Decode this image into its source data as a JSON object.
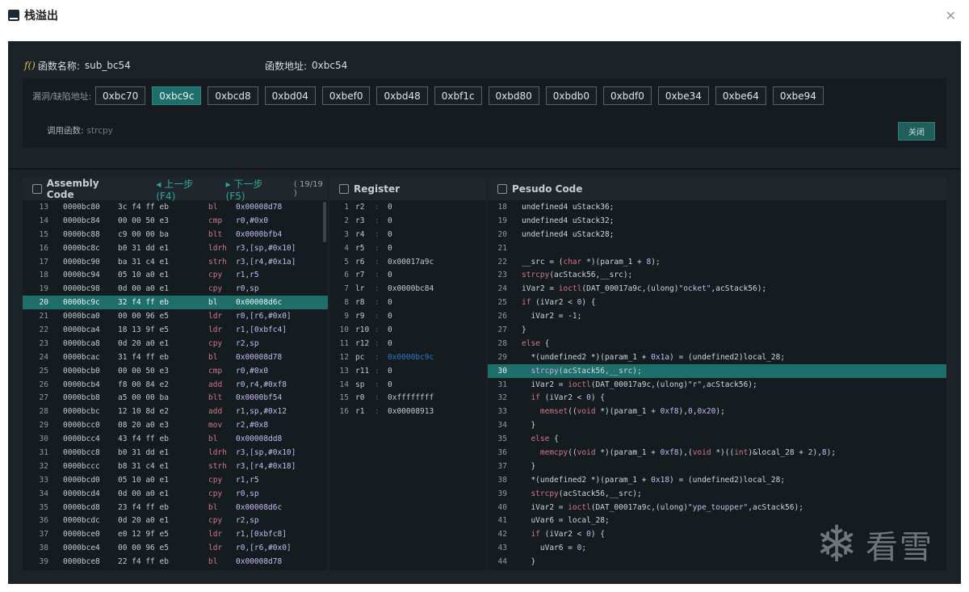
{
  "window": {
    "title": "栈溢出"
  },
  "function_info": {
    "name_label": "函数名称:",
    "name": "sub_bc54",
    "addr_label": "函数地址:",
    "addr": "0xbc54"
  },
  "vuln": {
    "label": "漏洞/缺陷地址:",
    "addresses": [
      "0xbc70",
      "0xbc9c",
      "0xbcd8",
      "0xbd04",
      "0xbef0",
      "0xbd48",
      "0xbf1c",
      "0xbd80",
      "0xbdb0",
      "0xbdf0",
      "0xbe34",
      "0xbe64",
      "0xbe94"
    ],
    "active_index": 1,
    "call_label": "调用函数:",
    "call_fn": "strcpy",
    "close_label": "关闭"
  },
  "assembly": {
    "title": "Assembly Code",
    "prev_label": "上一步(F4)",
    "next_label": "下一步(F5)",
    "step_count": "( 19/19 )",
    "highlight_line": "20",
    "rows": [
      {
        "ln": "13",
        "addr": "0000bc80",
        "bytes": "3c f4 ff eb",
        "mn": "bl",
        "op": "0x00008d78"
      },
      {
        "ln": "14",
        "addr": "0000bc84",
        "bytes": "00 00 50 e3",
        "mn": "cmp",
        "op": "r0,#0x0"
      },
      {
        "ln": "15",
        "addr": "0000bc88",
        "bytes": "c9 00 00 ba",
        "mn": "blt",
        "op": "0x0000bfb4"
      },
      {
        "ln": "16",
        "addr": "0000bc8c",
        "bytes": "b0 31 dd e1",
        "mn": "ldrh",
        "op": "r3,[sp,#0x10]"
      },
      {
        "ln": "17",
        "addr": "0000bc90",
        "bytes": "ba 31 c4 e1",
        "mn": "strh",
        "op": "r3,[r4,#0x1a]"
      },
      {
        "ln": "18",
        "addr": "0000bc94",
        "bytes": "05 10 a0 e1",
        "mn": "cpy",
        "op": "r1,r5"
      },
      {
        "ln": "19",
        "addr": "0000bc98",
        "bytes": "0d 00 a0 e1",
        "mn": "cpy",
        "op": "r0,sp"
      },
      {
        "ln": "20",
        "addr": "0000bc9c",
        "bytes": "32 f4 ff eb",
        "mn": "bl",
        "op": "0x00008d6c"
      },
      {
        "ln": "21",
        "addr": "0000bca0",
        "bytes": "00 00 96 e5",
        "mn": "ldr",
        "op": "r0,[r6,#0x0]"
      },
      {
        "ln": "22",
        "addr": "0000bca4",
        "bytes": "18 13 9f e5",
        "mn": "ldr",
        "op": "r1,[0xbfc4]"
      },
      {
        "ln": "23",
        "addr": "0000bca8",
        "bytes": "0d 20 a0 e1",
        "mn": "cpy",
        "op": "r2,sp"
      },
      {
        "ln": "24",
        "addr": "0000bcac",
        "bytes": "31 f4 ff eb",
        "mn": "bl",
        "op": "0x00008d78"
      },
      {
        "ln": "25",
        "addr": "0000bcb0",
        "bytes": "00 00 50 e3",
        "mn": "cmp",
        "op": "r0,#0x0"
      },
      {
        "ln": "26",
        "addr": "0000bcb4",
        "bytes": "f8 00 84 e2",
        "mn": "add",
        "op": "r0,r4,#0xf8"
      },
      {
        "ln": "27",
        "addr": "0000bcb8",
        "bytes": "a5 00 00 ba",
        "mn": "blt",
        "op": "0x0000bf54"
      },
      {
        "ln": "28",
        "addr": "0000bcbc",
        "bytes": "12 10 8d e2",
        "mn": "add",
        "op": "r1,sp,#0x12"
      },
      {
        "ln": "29",
        "addr": "0000bcc0",
        "bytes": "08 20 a0 e3",
        "mn": "mov",
        "op": "r2,#0x8"
      },
      {
        "ln": "30",
        "addr": "0000bcc4",
        "bytes": "43 f4 ff eb",
        "mn": "bl",
        "op": "0x00008dd8"
      },
      {
        "ln": "31",
        "addr": "0000bcc8",
        "bytes": "b0 31 dd e1",
        "mn": "ldrh",
        "op": "r3,[sp,#0x10]"
      },
      {
        "ln": "32",
        "addr": "0000bccc",
        "bytes": "b8 31 c4 e1",
        "mn": "strh",
        "op": "r3,[r4,#0x18]"
      },
      {
        "ln": "33",
        "addr": "0000bcd0",
        "bytes": "05 10 a0 e1",
        "mn": "cpy",
        "op": "r1,r5"
      },
      {
        "ln": "34",
        "addr": "0000bcd4",
        "bytes": "0d 00 a0 e1",
        "mn": "cpy",
        "op": "r0,sp"
      },
      {
        "ln": "35",
        "addr": "0000bcd8",
        "bytes": "23 f4 ff eb",
        "mn": "bl",
        "op": "0x00008d6c"
      },
      {
        "ln": "36",
        "addr": "0000bcdc",
        "bytes": "0d 20 a0 e1",
        "mn": "cpy",
        "op": "r2,sp"
      },
      {
        "ln": "37",
        "addr": "0000bce0",
        "bytes": "e0 12 9f e5",
        "mn": "ldr",
        "op": "r1,[0xbfc8]"
      },
      {
        "ln": "38",
        "addr": "0000bce4",
        "bytes": "00 00 96 e5",
        "mn": "ldr",
        "op": "r0,[r6,#0x0]"
      },
      {
        "ln": "39",
        "addr": "0000bce8",
        "bytes": "22 f4 ff eb",
        "mn": "bl",
        "op": "0x00008d78"
      }
    ]
  },
  "register": {
    "title": "Register",
    "rows": [
      {
        "ln": "1",
        "name": "r2",
        "sep": ":",
        "value": "0",
        "changed": false
      },
      {
        "ln": "2",
        "name": "r3",
        "sep": ":",
        "value": "0",
        "changed": false
      },
      {
        "ln": "3",
        "name": "r4",
        "sep": ":",
        "value": "0",
        "changed": false
      },
      {
        "ln": "4",
        "name": "r5",
        "sep": ":",
        "value": "0",
        "changed": false
      },
      {
        "ln": "5",
        "name": "r6",
        "sep": ":",
        "value": "0x00017a9c",
        "changed": false
      },
      {
        "ln": "6",
        "name": "r7",
        "sep": ":",
        "value": "0",
        "changed": false
      },
      {
        "ln": "7",
        "name": "lr",
        "sep": ":",
        "value": "0x0000bc84",
        "changed": false
      },
      {
        "ln": "8",
        "name": "r8",
        "sep": ":",
        "value": "0",
        "changed": false
      },
      {
        "ln": "9",
        "name": "r9",
        "sep": ":",
        "value": "0",
        "changed": false
      },
      {
        "ln": "10",
        "name": "r10",
        "sep": ":",
        "value": "0",
        "changed": false
      },
      {
        "ln": "11",
        "name": "r12",
        "sep": ":",
        "value": "0",
        "changed": false
      },
      {
        "ln": "12",
        "name": "pc",
        "sep": ":",
        "value": "0x0000bc9c",
        "changed": true
      },
      {
        "ln": "13",
        "name": "r11",
        "sep": ":",
        "value": "0",
        "changed": false
      },
      {
        "ln": "14",
        "name": "sp",
        "sep": ":",
        "value": "0",
        "changed": false
      },
      {
        "ln": "15",
        "name": "r0",
        "sep": ":",
        "value": "0xffffffff",
        "changed": false
      },
      {
        "ln": "16",
        "name": "r1",
        "sep": ":",
        "value": "0x00008913",
        "changed": false
      }
    ]
  },
  "pseudo": {
    "title": "Pesudo Code",
    "highlight_line": "30",
    "rows": [
      {
        "ln": "18",
        "code": "undefined4 uStack36;"
      },
      {
        "ln": "19",
        "code": "undefined4 uStack32;"
      },
      {
        "ln": "20",
        "code": "undefined4 uStack28;"
      },
      {
        "ln": "21",
        "code": ""
      },
      {
        "ln": "22",
        "code": "__src = (char *)(param_1 + 8);"
      },
      {
        "ln": "23",
        "code": "strcpy(acStack56,__src);"
      },
      {
        "ln": "24",
        "code": "iVar2 = ioctl(DAT_00017a9c,(ulong)\"ocket\",acStack56);"
      },
      {
        "ln": "25",
        "code": "if (iVar2 < 0) {"
      },
      {
        "ln": "26",
        "code": "  iVar2 = -1;"
      },
      {
        "ln": "27",
        "code": "}"
      },
      {
        "ln": "28",
        "code": "else {"
      },
      {
        "ln": "29",
        "code": "  *(undefined2 *)(param_1 + 0x1a) = (undefined2)local_28;"
      },
      {
        "ln": "30",
        "code": "  strcpy(acStack56,__src);"
      },
      {
        "ln": "31",
        "code": "  iVar2 = ioctl(DAT_00017a9c,(ulong)\"r\",acStack56);"
      },
      {
        "ln": "32",
        "code": "  if (iVar2 < 0) {"
      },
      {
        "ln": "33",
        "code": "    memset((void *)(param_1 + 0xf8),0,0x20);"
      },
      {
        "ln": "34",
        "code": "  }"
      },
      {
        "ln": "35",
        "code": "  else {"
      },
      {
        "ln": "36",
        "code": "    memcpy((void *)(param_1 + 0xf8),(void *)((int)&local_28 + 2),8);"
      },
      {
        "ln": "37",
        "code": "  }"
      },
      {
        "ln": "38",
        "code": "  *(undefined2 *)(param_1 + 0x18) = (undefined2)local_28;"
      },
      {
        "ln": "39",
        "code": "  strcpy(acStack56,__src);"
      },
      {
        "ln": "40",
        "code": "  iVar2 = ioctl(DAT_00017a9c,(ulong)\"ype_toupper\",acStack56);"
      },
      {
        "ln": "41",
        "code": "  uVar6 = local_28;"
      },
      {
        "ln": "42",
        "code": "  if (iVar2 < 0) {"
      },
      {
        "ln": "43",
        "code": "    uVar6 = 0;"
      },
      {
        "ln": "44",
        "code": "  }"
      }
    ]
  },
  "watermark": {
    "text": "看雪"
  }
}
